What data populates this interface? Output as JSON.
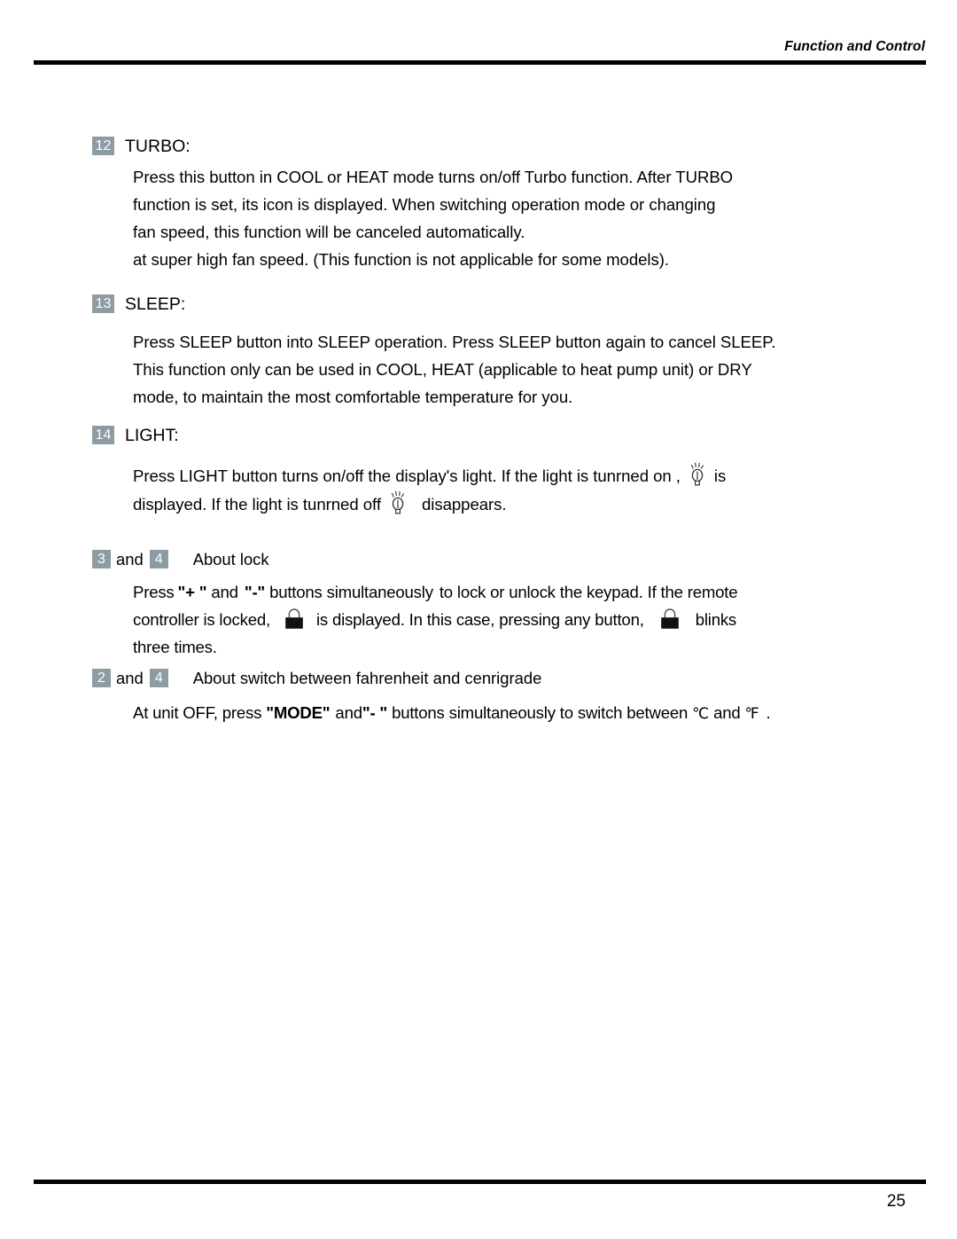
{
  "header": {
    "title": "Function and Control"
  },
  "footer": {
    "page_number": "25"
  },
  "sections": {
    "turbo": {
      "number": "12",
      "title": "TURBO:",
      "lines": [
        "Press this button in COOL or HEAT mode turns on/off Turbo function. After TURBO",
        "function is set, its icon is displayed. When switching operation mode or changing",
        "fan speed, this function will be canceled automatically.",
        "at super high fan speed. (This function is not applicable for some models)."
      ]
    },
    "sleep": {
      "number": "13",
      "title": "SLEEP:",
      "lines": [
        "Press SLEEP button into SLEEP operation. Press SLEEP button again to cancel SLEEP.",
        "This function only can be used in COOL, HEAT (applicable to heat pump unit) or DRY",
        "mode, to maintain the most comfortable temperature for you."
      ]
    },
    "light": {
      "number": "14",
      "title": "LIGHT:",
      "line1_before": "Press LIGHT button turns on/off the display's light. If the light is tunrned on ,",
      "line1_after": "is",
      "line2_before": "displayed. If the light is tunrned off",
      "line2_after": "disappears.",
      "bulb_icon": "light-bulb-icon"
    },
    "lock": {
      "number_a": "3",
      "and": "and",
      "number_b": "4",
      "title": "About lock",
      "line1_a": "Press",
      "line1_plus": "\"+ \"",
      "line1_b": "and",
      "line1_minus": "\"-\"",
      "line1_c": "buttons simultaneously",
      "line1_d": "to lock or unlock the keypad. If the remote",
      "line2_a": "controller is locked,",
      "line2_b": "is displayed. In this case, pressing any button,",
      "line2_c": "blinks",
      "line3": "three times.",
      "lock_icon": "padlock-icon"
    },
    "units": {
      "number_a": "2",
      "and": "and",
      "number_b": "4",
      "title": "About switch between fahrenheit and cenrigrade",
      "line_a": "At unit OFF, press",
      "line_mode": "\"MODE\"",
      "line_b": "and",
      "line_minus": "\"- \"",
      "line_c": "buttons simultaneously to switch between",
      "celsius": "℃",
      "line_d": "and",
      "fahrenheit": "℉",
      "line_e": "."
    }
  },
  "colors": {
    "badge_background": "#8d9ba3",
    "badge_text": "#ffffff",
    "rule": "#000000",
    "text": "#000000"
  }
}
